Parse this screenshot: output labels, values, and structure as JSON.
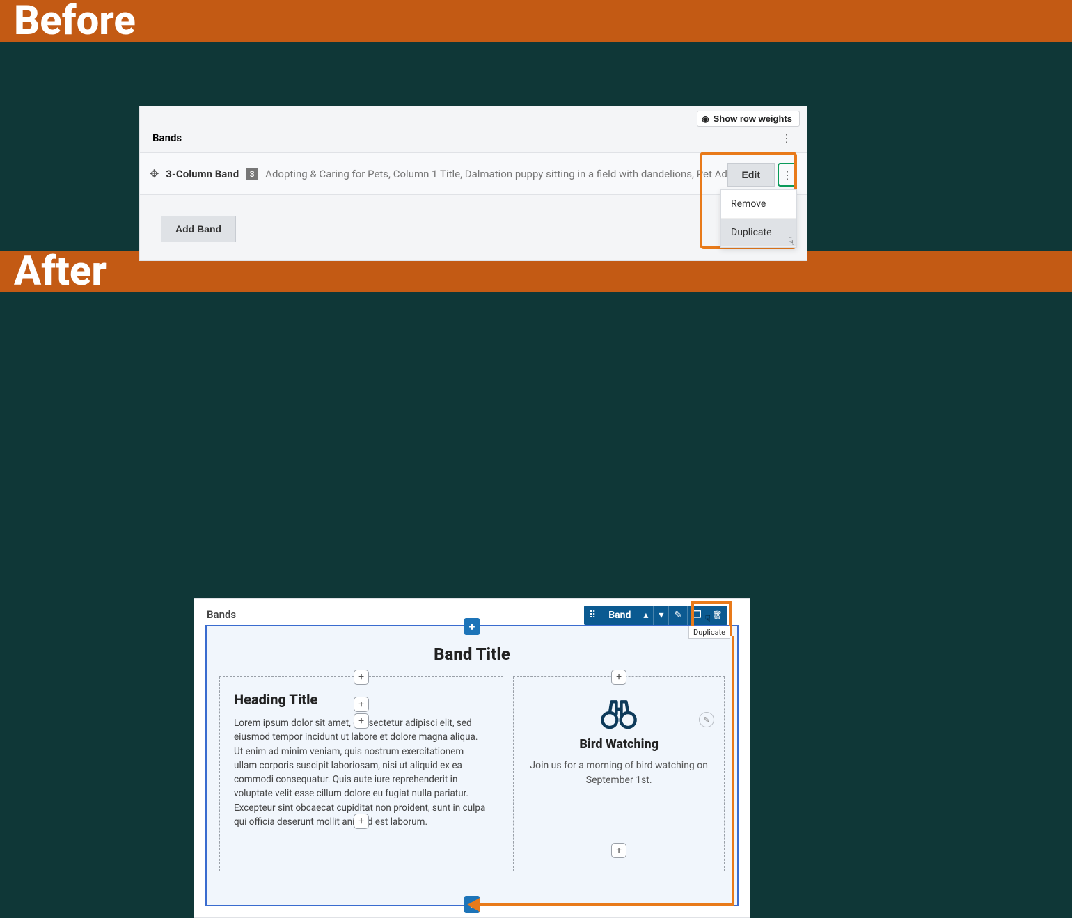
{
  "banners": {
    "before": "Before",
    "after": "After"
  },
  "before": {
    "show_weights": "Show row weights",
    "panel_title": "Bands",
    "row": {
      "title": "3-Column Band",
      "count": "3",
      "description": "Adopting & Caring for Pets, Column 1 Title, Dalmation puppy sitting in a field with dandelions, Pet Ad…",
      "edit": "Edit"
    },
    "dropdown": {
      "remove": "Remove",
      "duplicate": "Duplicate"
    },
    "add_band": "Add Band"
  },
  "after": {
    "panel_title": "Bands",
    "toolbar_label": "Band",
    "tooltip": "Duplicate",
    "band_title": "Band Title",
    "left": {
      "heading": "Heading Title",
      "body": "Lorem ipsum dolor sit amet, consectetur adipisci elit, sed eiusmod tempor incidunt ut labore et dolore magna aliqua. Ut enim ad minim veniam, quis nostrum exercitationem ullam corporis suscipit laboriosam, nisi ut aliquid ex ea commodi consequatur. Quis aute iure reprehenderit in voluptate velit esse cillum dolore eu fugiat nulla pariatur. Excepteur sint obcaecat cupiditat non proident, sunt in culpa qui officia deserunt mollit anim id est laborum."
    },
    "right": {
      "title": "Bird Watching",
      "body": "Join us for a morning of bird watching on September 1st."
    }
  },
  "colors": {
    "accent": "#e87a1a",
    "toolbar": "#0b5a91",
    "canvas_border": "#3a6ccf"
  }
}
